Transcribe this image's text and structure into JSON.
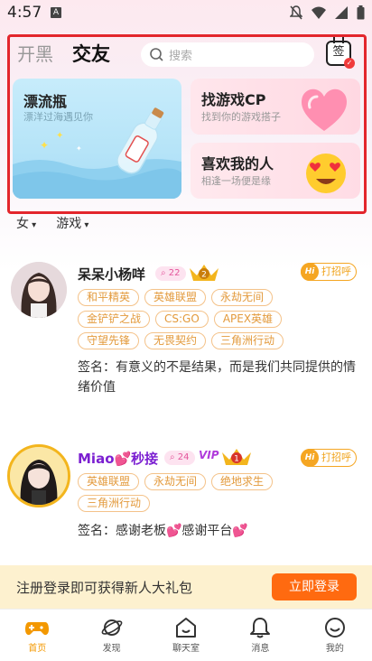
{
  "status_bar": {
    "time": "4:57",
    "app_badge": "A"
  },
  "header": {
    "tabs": [
      {
        "label": "开黑"
      },
      {
        "label": "交友"
      }
    ],
    "search_placeholder": "搜索",
    "signin_label": "签"
  },
  "cards": {
    "bottle": {
      "title": "漂流瓶",
      "subtitle": "漂洋过海遇见你"
    },
    "cp": {
      "title": "找游戏CP",
      "subtitle": "找到你的游戏搭子"
    },
    "like": {
      "title": "喜欢我的人",
      "subtitle": "相逢一场便是缘"
    }
  },
  "filters": [
    {
      "label": "女"
    },
    {
      "label": "游戏"
    }
  ],
  "users": [
    {
      "name": "呆呆小杨咩",
      "level": "22",
      "rank": "2",
      "greet_label": "打招呼",
      "tags": [
        "和平精英",
        "英雄联盟",
        "永劫无间",
        "金铲铲之战",
        "CS:GO",
        "APEX英雄",
        "守望先锋",
        "无畏契约",
        "三角洲行动"
      ],
      "signature": "签名：有意义的不是结果，而是我们共同提供的情绪价值"
    },
    {
      "name": "Miao💕秒接",
      "level": "24",
      "rank": "1",
      "vip": "VIP",
      "greet_label": "打招呼",
      "tags": [
        "英雄联盟",
        "永劫无间",
        "绝地求生",
        "三角洲行动"
      ],
      "signature": "签名：感谢老板💕感谢平台💕"
    }
  ],
  "banner": {
    "text": "注册登录即可获得新人大礼包",
    "button": "立即登录"
  },
  "nav": [
    {
      "label": "首页",
      "icon": "gamepad-icon",
      "active": true
    },
    {
      "label": "发现",
      "icon": "planet-icon"
    },
    {
      "label": "聊天室",
      "icon": "home-chat-icon"
    },
    {
      "label": "消息",
      "icon": "bell-icon"
    },
    {
      "label": "我的",
      "icon": "smile-icon"
    }
  ],
  "colors": {
    "accent": "#ff6a10",
    "highlight_frame": "#e3262c",
    "tag": "#e39a3c",
    "active_nav": "#f39800"
  }
}
